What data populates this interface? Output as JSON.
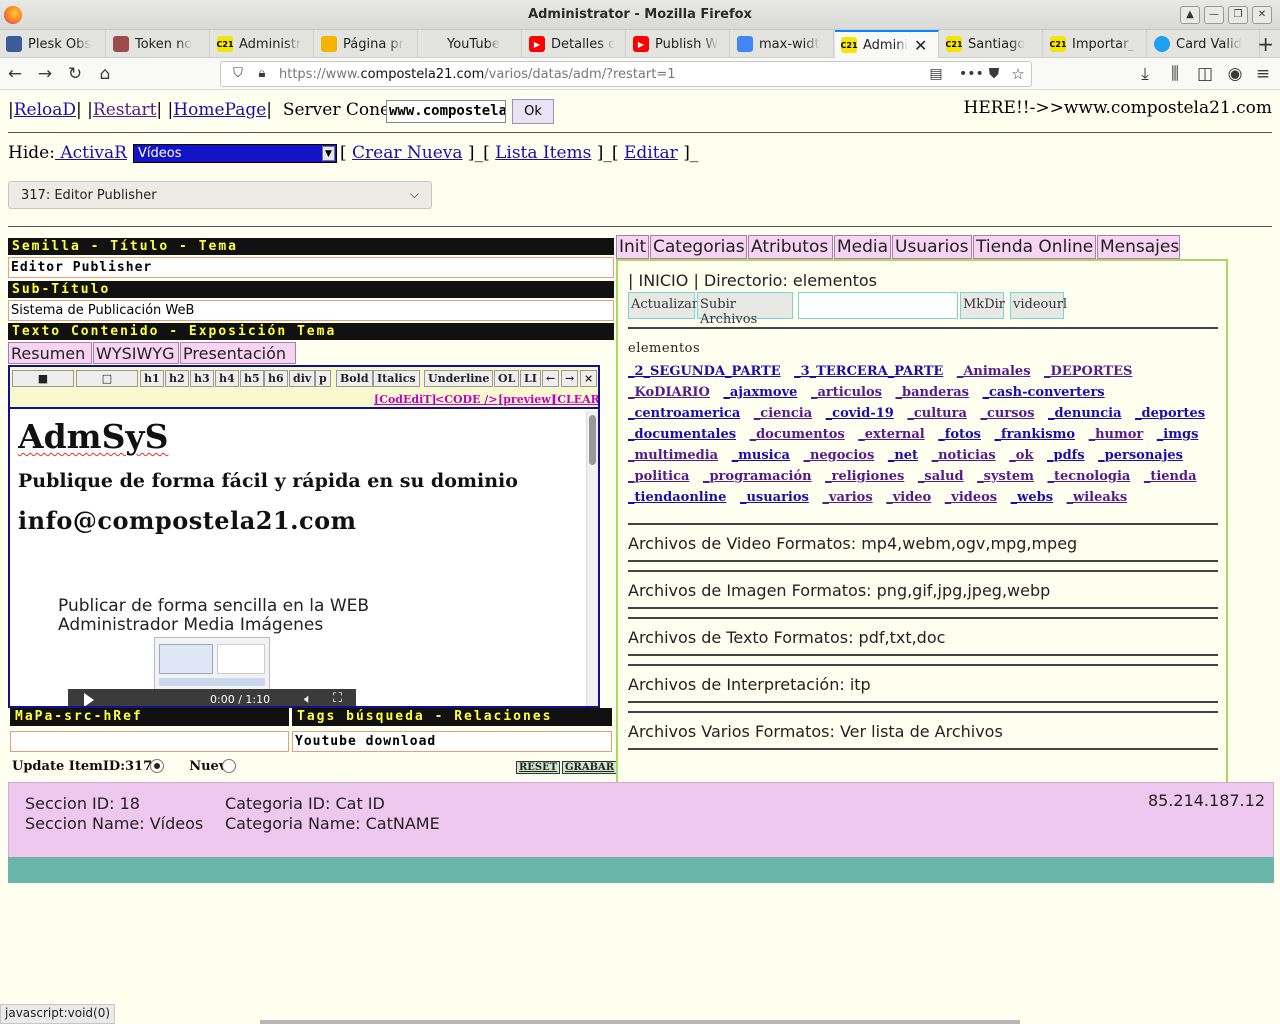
{
  "window": {
    "title": "Administrator - Mozilla Firefox"
  },
  "tabs": [
    {
      "label": "Plesk Obs",
      "icon": "plesk-icon",
      "color": "#3b5b9d"
    },
    {
      "label": "Token no",
      "icon": "shield-icon",
      "color": "#9c4c4c"
    },
    {
      "label": "Administr",
      "icon": "c21-icon",
      "color": "#f5e600"
    },
    {
      "label": "Página pr",
      "icon": "google-ads-icon",
      "color": "#f4b400"
    },
    {
      "label": "YouTube",
      "icon": "blank-icon",
      "color": "#e3e3df"
    },
    {
      "label": "Detalles c",
      "icon": "youtube-icon",
      "color": "#ff0000"
    },
    {
      "label": "Publish W",
      "icon": "youtube-icon",
      "color": "#ff0000"
    },
    {
      "label": "max-widt",
      "icon": "google-icon",
      "color": "#4285f4"
    },
    {
      "label": "Admini",
      "icon": "c21-icon",
      "color": "#f5e600"
    },
    {
      "label": "Santiago",
      "icon": "c21-icon",
      "color": "#f5e600"
    },
    {
      "label": "Importar_",
      "icon": "c21-icon",
      "color": "#f5e600"
    },
    {
      "label": "Card Valid",
      "icon": "twitter-icon",
      "color": "#1da1f2"
    }
  ],
  "favicon_text": "C21",
  "address": {
    "prefix": "https://www.",
    "domain": "compostela21.com",
    "path": "/varios/datas/adm/?restart=1"
  },
  "topline": {
    "reload": "ReloaD",
    "restart": "Restart",
    "homepage": "HomePage",
    "server_label": "Server Conex:",
    "server_value": "www.compostela21.com",
    "ok": "Ok",
    "here": "HERE!!->>www.compostela21.com"
  },
  "hideline": {
    "hide_label": "Hide:",
    "activar": " ActivaR",
    "section_value": "Vídeos",
    "crear": "Crear Nueva",
    "lista": "Lista Items",
    "editar": "Editar"
  },
  "editor_select": "317: Editor Publisher",
  "form": {
    "semilla_label": "Semilla - Título - Tema",
    "title_value": "Editor Publisher",
    "subtitulo_label": "Sub-Título",
    "subtitulo_value": "Sistema de Publicación WeB",
    "texto_label": "Texto Contenido - Exposición Tema",
    "tabs": [
      "Resumen",
      "WYSIWYG",
      "Presentación"
    ],
    "toolbar_buttons": [
      "h1",
      "h2",
      "h3",
      "h4",
      "h5",
      "h6",
      "div",
      "p",
      "Bold",
      "Italics",
      "Underline",
      "OL",
      "LI",
      "←",
      "→",
      "×"
    ],
    "toolbar_links": [
      "[CodEdiT]",
      "<CODE />",
      "[preview]",
      "[CLEAR]"
    ],
    "content": {
      "h1": "AdmSyS",
      "h3": "Publique de forma fácil y rápida en su dominio",
      "h2": "info@compostela21.com",
      "p_line1": "Publicar de forma sencilla en la WEB",
      "p_line2": "Administrador Media Imágenes",
      "video_time": "0:00 / 1:10"
    },
    "mapa_label": "MaPa-src-hRef",
    "mapa_value": "",
    "tags_label": "Tags búsqueda - Relaciones",
    "tags_value": "Youtube download",
    "update_label": "Update ItemID:317",
    "nuevo_label": "Nuevo",
    "reset": "RESET",
    "grabar": "GRABAR"
  },
  "right": {
    "tabs": [
      "Init",
      "Categorias",
      "Atributos",
      "Media",
      "Usuarios",
      "Tienda Online",
      "Mensajes"
    ],
    "dir_text": "| INICIO | Directorio: elementos",
    "buttons": {
      "actualizar": "Actualizar",
      "subir": "Subir Archivos",
      "mkdir": "MkDir",
      "videourl": "videourl"
    },
    "elements_label": "elementos",
    "folders": [
      {
        "name": "_2_SEGUNDA_PARTE",
        "v": false
      },
      {
        "name": "_3_TERCERA_PARTE",
        "v": false
      },
      {
        "name": "_Animales",
        "v": true
      },
      {
        "name": "_DEPORTES",
        "v": true
      },
      {
        "name": "_KoDIARIO",
        "v": true
      },
      {
        "name": "_ajaxmove",
        "v": false
      },
      {
        "name": "_articulos",
        "v": true
      },
      {
        "name": "_banderas",
        "v": true
      },
      {
        "name": "_cash-converters",
        "v": false
      },
      {
        "name": "_centroamerica",
        "v": false
      },
      {
        "name": "_ciencia",
        "v": true
      },
      {
        "name": "_covid-19",
        "v": false
      },
      {
        "name": "_cultura",
        "v": true
      },
      {
        "name": "_cursos",
        "v": true
      },
      {
        "name": "_denuncia",
        "v": false
      },
      {
        "name": "_deportes",
        "v": false
      },
      {
        "name": "_documentales",
        "v": false
      },
      {
        "name": "_documentos",
        "v": true
      },
      {
        "name": "_external",
        "v": true
      },
      {
        "name": "_fotos",
        "v": false
      },
      {
        "name": "_frankismo",
        "v": false
      },
      {
        "name": "_humor",
        "v": true
      },
      {
        "name": "_imgs",
        "v": false
      },
      {
        "name": "_multimedia",
        "v": true
      },
      {
        "name": "_musica",
        "v": false
      },
      {
        "name": "_negocios",
        "v": true
      },
      {
        "name": "_net",
        "v": false
      },
      {
        "name": "_noticias",
        "v": true
      },
      {
        "name": "_ok",
        "v": true
      },
      {
        "name": "_pdfs",
        "v": false
      },
      {
        "name": "_personajes",
        "v": false
      },
      {
        "name": "_politica",
        "v": true
      },
      {
        "name": "_programación",
        "v": true
      },
      {
        "name": "_religiones",
        "v": true
      },
      {
        "name": "_salud",
        "v": true
      },
      {
        "name": "_system",
        "v": true
      },
      {
        "name": "_tecnologia",
        "v": true
      },
      {
        "name": "_tienda",
        "v": true
      },
      {
        "name": "_tiendaonline",
        "v": false
      },
      {
        "name": "_usuarios",
        "v": false
      },
      {
        "name": "_varios",
        "v": true
      },
      {
        "name": "_video",
        "v": true
      },
      {
        "name": "_videos",
        "v": true
      },
      {
        "name": "_webs",
        "v": false
      },
      {
        "name": "_wileaks",
        "v": true
      }
    ],
    "formats": [
      "Archivos de Video Formatos: mp4,webm,ogv,mpg,mpeg",
      "Archivos de Imagen Formatos: png,gif,jpg,jpeg,webp",
      "Archivos de Texto Formatos: pdf,txt,doc",
      "Archivos de Interpretación: itp",
      "Archivos Varios Formatos: Ver lista de Archivos"
    ]
  },
  "info": {
    "seccion_id": "Seccion ID: 18",
    "seccion_name": "Seccion Name: Vídeos",
    "categoria_id": "Categoria ID: Cat ID",
    "categoria_name": "Categoria Name: CatNAME",
    "ip": "85.214.187.12"
  },
  "statusbar": "javascript:void(0)"
}
